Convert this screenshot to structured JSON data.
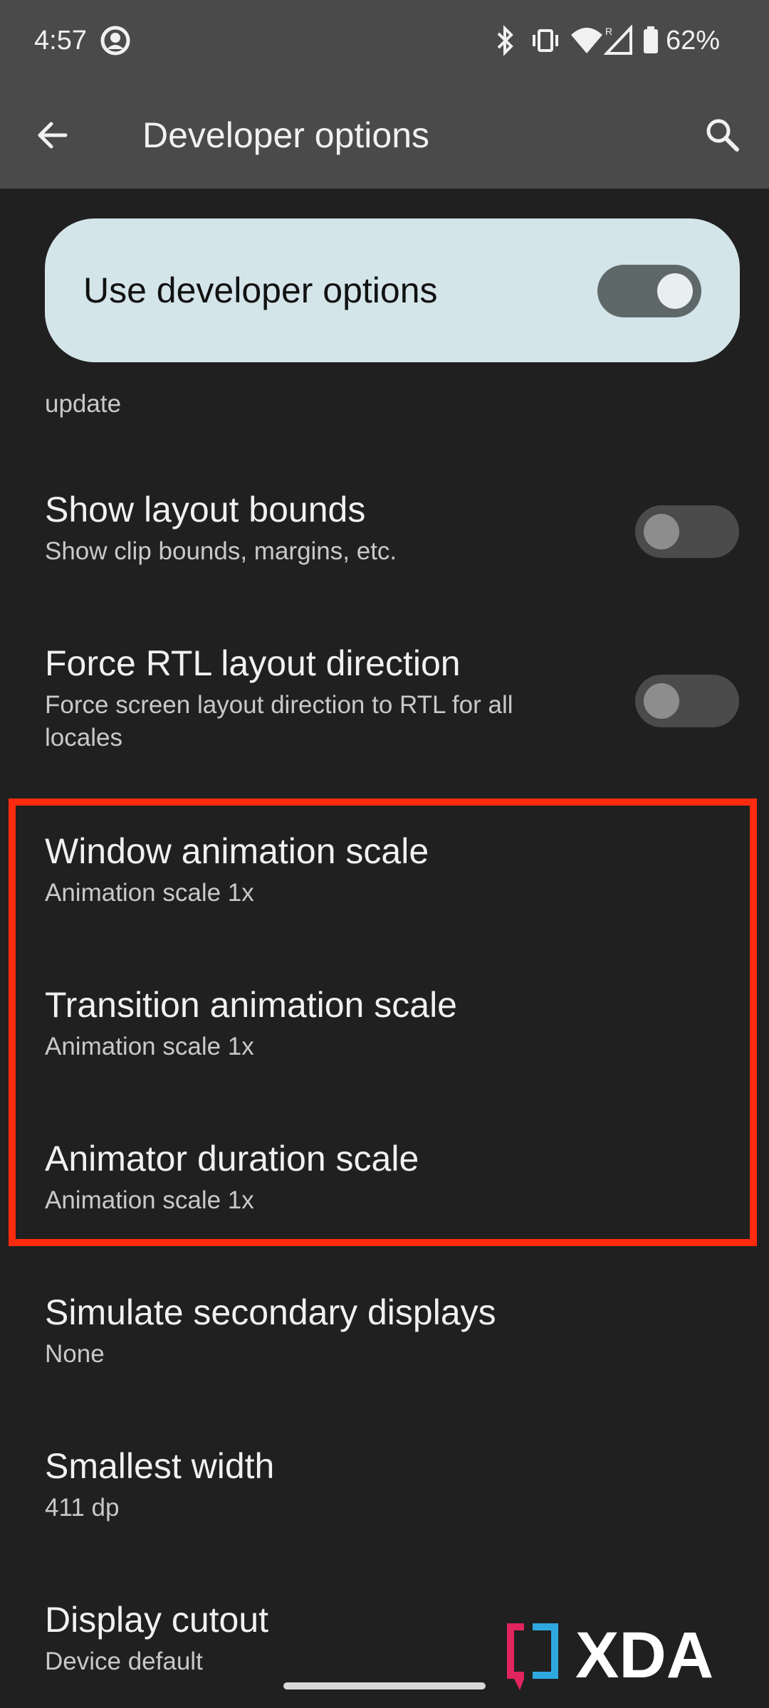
{
  "status_bar": {
    "time": "4:57",
    "battery_percent": "62%",
    "icons": [
      "circle-app-icon",
      "bluetooth-icon",
      "vibrate-icon",
      "wifi-icon",
      "cell-signal-roaming-icon",
      "battery-icon"
    ]
  },
  "app_bar": {
    "title": "Developer options",
    "back_icon": "back-arrow-icon",
    "search_icon": "search-icon"
  },
  "master_switch": {
    "label": "Use developer options",
    "enabled": true
  },
  "cut_off_summary": "update",
  "settings": [
    {
      "title": "Show layout bounds",
      "summary": "Show clip bounds, margins, etc.",
      "toggle": false
    },
    {
      "title": "Force RTL layout direction",
      "summary": "Force screen layout direction to RTL for all locales",
      "toggle": false
    },
    {
      "title": "Window animation scale",
      "summary": "Animation scale 1x"
    },
    {
      "title": "Transition animation scale",
      "summary": "Animation scale 1x"
    },
    {
      "title": "Animator duration scale",
      "summary": "Animation scale 1x"
    },
    {
      "title": "Simulate secondary displays",
      "summary": "None"
    },
    {
      "title": "Smallest width",
      "summary": "411 dp"
    },
    {
      "title": "Display cutout",
      "summary": "Device default"
    }
  ],
  "highlight_color": "#ff2b0f",
  "watermark": {
    "text": "XDA"
  }
}
